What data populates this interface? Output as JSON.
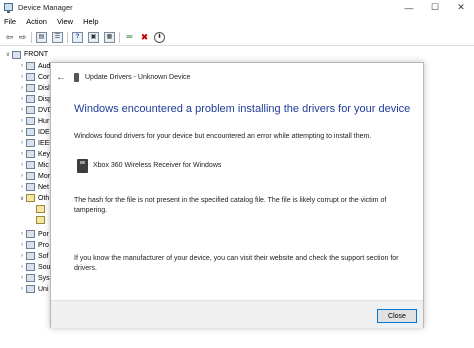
{
  "window": {
    "title": "Device Manager",
    "controls": {
      "minimize": "—",
      "maximize": "☐",
      "close": "✕"
    }
  },
  "menu": [
    "File",
    "Action",
    "View",
    "Help"
  ],
  "toolbar": {
    "back": "⇦",
    "forward": "⇨",
    "box1": "▤",
    "box2": "☰",
    "help": "?",
    "box3": "▣",
    "scan": "▦",
    "update": "⮹",
    "remove": "✖",
    "download": "⬇"
  },
  "icons": {
    "chevron_down": "∨",
    "chevron_right": "›",
    "back_arrow": "←"
  },
  "tree": {
    "root": "FRONT",
    "items": [
      "Aud",
      "Cor",
      "Disl",
      "Disp",
      "DVD",
      "Hur",
      "IDE",
      "IEEE",
      "Key",
      "Mic",
      "Mor",
      "Net",
      "Oth",
      "",
      "",
      "Por",
      "Pro",
      "Sof",
      "Sou",
      "Sys",
      "Uni"
    ]
  },
  "dialog": {
    "header_title": "Update Drivers - Unknown Device",
    "heading": "Windows encountered a problem installing the drivers for your device",
    "found_text": "Windows found drivers for your device but encountered an error while attempting to install them.",
    "device_name": "Xbox 360 Wireless Receiver for Windows",
    "hash_text": "The hash for the file is not present in the specified catalog file. The file is likely corrupt or the victim of tampering.",
    "manufacturer_text": "If you know the manufacturer of your device, you can visit their website and check the support section for drivers.",
    "close_label": "Close"
  },
  "colors": {
    "heading_blue": "#1f3d99",
    "button_focus_border": "#0078d7",
    "remove_red": "#c00000"
  }
}
